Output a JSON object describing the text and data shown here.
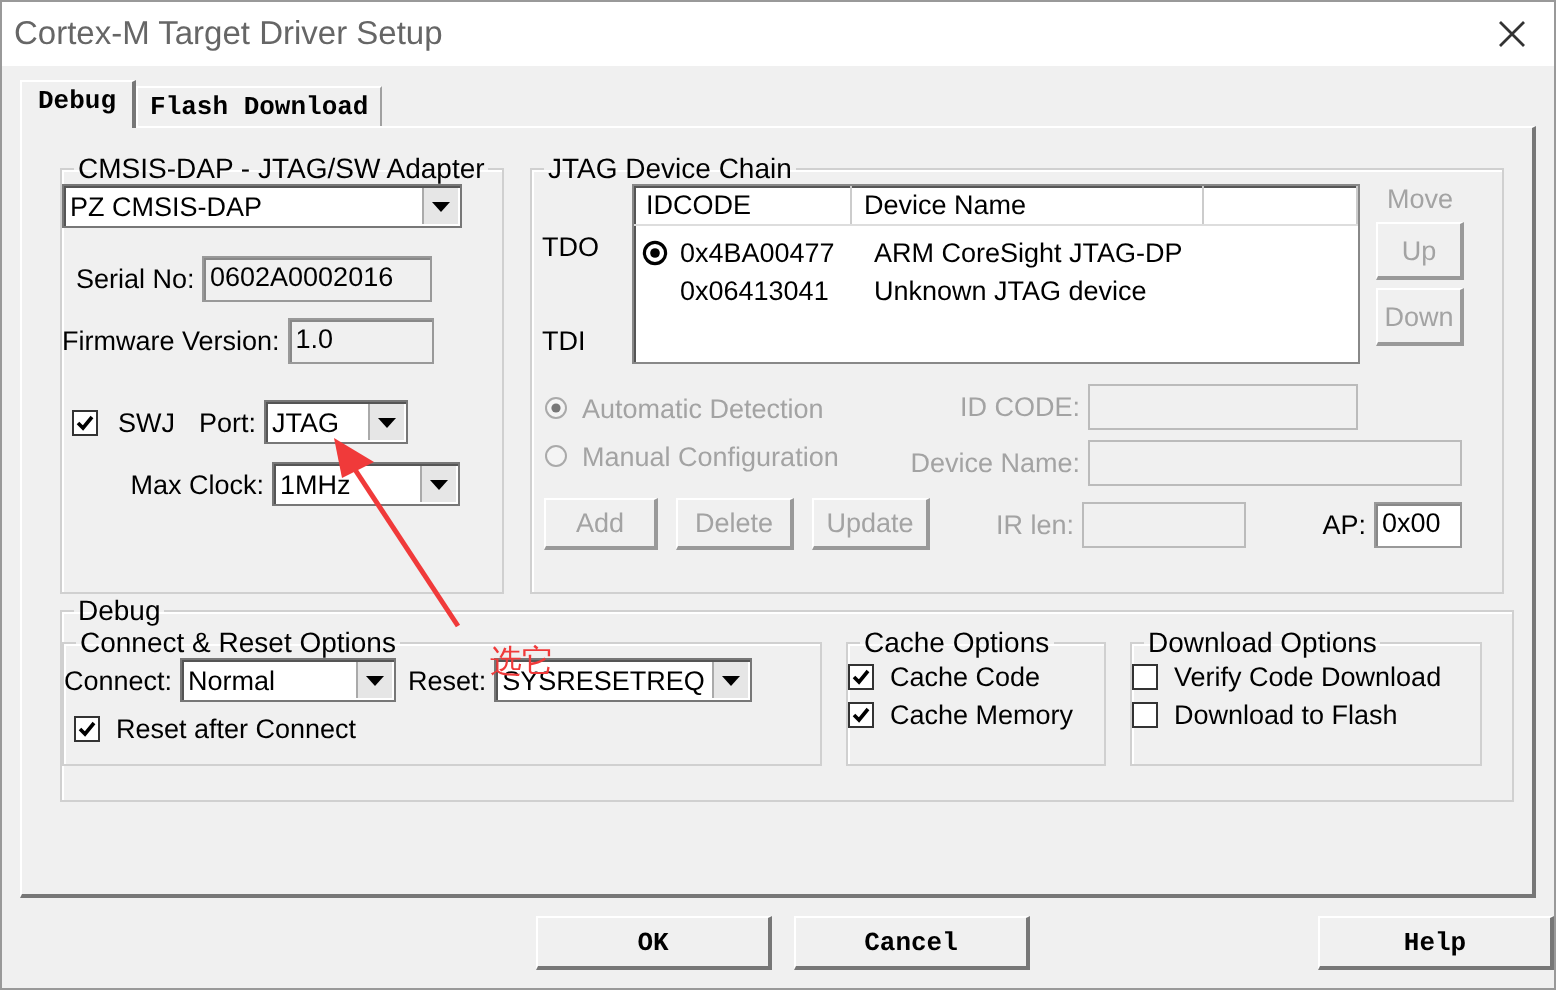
{
  "window": {
    "title": "Cortex-M Target Driver Setup"
  },
  "tabs": [
    {
      "label": "Debug",
      "selected": true
    },
    {
      "label": "Flash Download",
      "selected": false
    }
  ],
  "adapter": {
    "title": "CMSIS-DAP - JTAG/SW Adapter",
    "device": "PZ CMSIS-DAP",
    "serial_label": "Serial No:",
    "serial": "0602A0002016",
    "firmware_label": "Firmware Version:",
    "firmware": "1.0",
    "swj": {
      "label": "SWJ",
      "checked": true
    },
    "port_label": "Port:",
    "port": "JTAG",
    "clock_label": "Max Clock:",
    "clock": "1MHz"
  },
  "jtag_chain": {
    "title": "JTAG Device Chain",
    "tdo": "TDO",
    "tdi": "TDI",
    "columns": [
      "IDCODE",
      "Device Name"
    ],
    "rows": [
      {
        "idcode": "0x4BA00477",
        "name": "ARM CoreSight JTAG-DP",
        "selected": true
      },
      {
        "idcode": "0x06413041",
        "name": "Unknown JTAG device",
        "selected": false
      }
    ],
    "move_label": "Move",
    "move_buttons": [
      {
        "label": "Up",
        "disabled": true
      },
      {
        "label": "Down",
        "disabled": true
      }
    ],
    "detection": [
      {
        "label": "Automatic Detection",
        "selected": true,
        "disabled": true
      },
      {
        "label": "Manual Configuration",
        "selected": false,
        "disabled": true
      }
    ],
    "id_code_label": "ID CODE:",
    "device_name_label": "Device Name:",
    "ir_len_label": "IR len:",
    "ap_label": "AP:",
    "ap": "0x00",
    "buttons": [
      {
        "label": "Add",
        "disabled": true
      },
      {
        "label": "Delete",
        "disabled": true
      },
      {
        "label": "Update",
        "disabled": true
      }
    ]
  },
  "debug": {
    "title": "Debug",
    "connect_reset": {
      "title": "Connect & Reset Options",
      "connect_label": "Connect:",
      "connect": "Normal",
      "reset_label": "Reset:",
      "reset": "SYSRESETREQ",
      "reset_after_connect": {
        "label": "Reset after Connect",
        "checked": true
      }
    },
    "cache": {
      "title": "Cache Options",
      "options": [
        {
          "label": "Cache Code",
          "checked": true
        },
        {
          "label": "Cache Memory",
          "checked": true
        }
      ]
    },
    "download": {
      "title": "Download Options",
      "options": [
        {
          "label": "Verify Code Download",
          "checked": false
        },
        {
          "label": "Download to Flash",
          "checked": false
        }
      ]
    }
  },
  "annotation": {
    "text": "选它"
  },
  "buttons": [
    "OK",
    "Cancel",
    "Help"
  ]
}
